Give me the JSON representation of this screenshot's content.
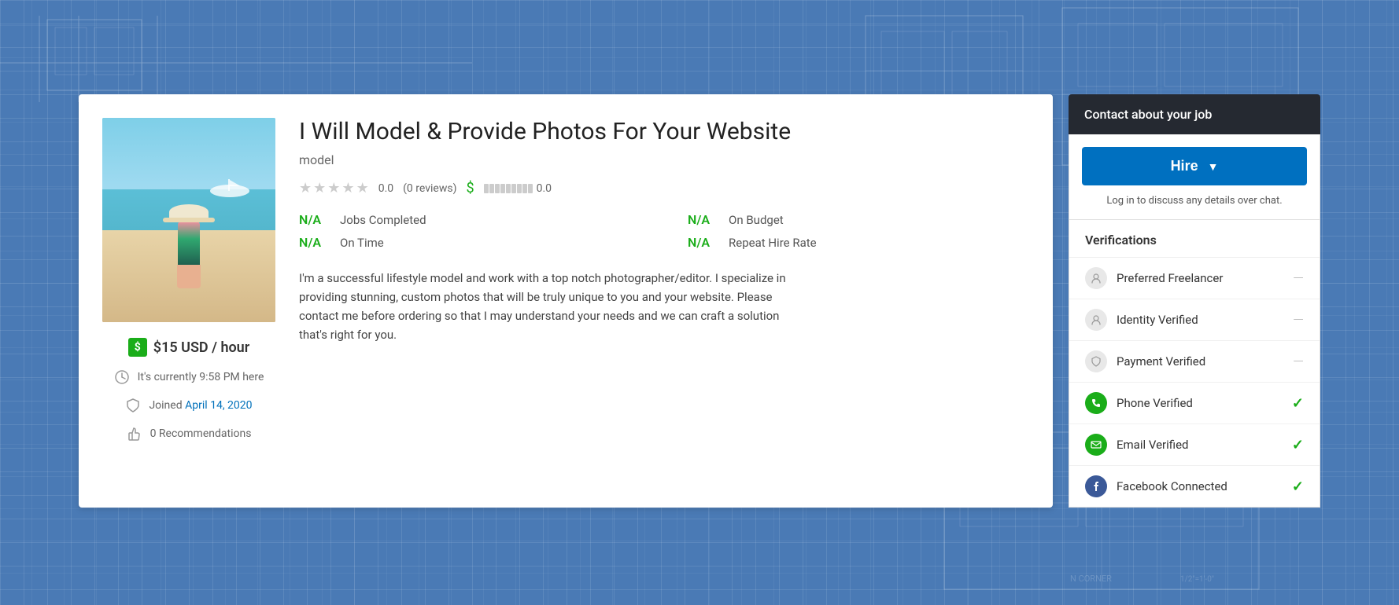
{
  "background": {
    "color": "#4a7ab5"
  },
  "contact": {
    "header": "Contact about your job",
    "hire_button": "Hire",
    "login_text": "Log in to discuss any details over chat."
  },
  "profile": {
    "title": "I Will Model & Provide Photos For Your Website",
    "category": "model",
    "rating": "0.0",
    "reviews": "(0 reviews)",
    "earnings": "0.0",
    "rate": "$15 USD / hour",
    "time": "It's currently 9:58 PM here",
    "joined": "Joined April 14, 2020",
    "recommendations": "0 Recommendations",
    "description": "I'm a successful lifestyle model and work with a top notch photographer/editor.  I specialize in providing stunning, custom photos that will be truly unique to you and your website. Please contact me before ordering so that I may understand your needs and we can craft a solution that's right for you.",
    "stats": {
      "jobs_completed": {
        "value": "N/A",
        "label": "Jobs Completed"
      },
      "on_budget": {
        "value": "N/A",
        "label": "On Budget"
      },
      "on_time": {
        "value": "N/A",
        "label": "On Time"
      },
      "repeat_hire": {
        "value": "N/A",
        "label": "Repeat Hire Rate"
      }
    }
  },
  "verifications": {
    "title": "Verifications",
    "items": [
      {
        "label": "Preferred Freelancer",
        "status": "dash",
        "icon_type": "gray"
      },
      {
        "label": "Identity Verified",
        "status": "dash",
        "icon_type": "gray"
      },
      {
        "label": "Payment Verified",
        "status": "dash",
        "icon_type": "shield"
      },
      {
        "label": "Phone Verified",
        "status": "check",
        "icon_type": "green"
      },
      {
        "label": "Email Verified",
        "status": "check",
        "icon_type": "green"
      },
      {
        "label": "Facebook Connected",
        "status": "check",
        "icon_type": "facebook"
      }
    ]
  }
}
